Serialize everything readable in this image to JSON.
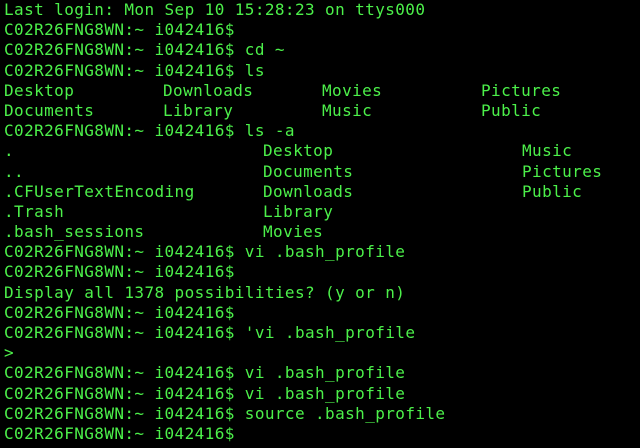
{
  "colors": {
    "background": "#000000",
    "text": "#4CF04A"
  },
  "terminal": {
    "login_line": "Last login: Mon Sep 10 15:28:23 on ttys000",
    "prompt": "C02R26FNG8WN:~ i042416$",
    "lines": [
      {
        "type": "prompt",
        "command": ""
      },
      {
        "type": "prompt",
        "command": "cd ~"
      },
      {
        "type": "prompt",
        "command": "ls"
      },
      {
        "type": "ls4",
        "cells": [
          "Desktop",
          "Downloads",
          "Movies",
          "Pictures"
        ]
      },
      {
        "type": "ls4",
        "cells": [
          "Documents",
          "Library",
          "Music",
          "Public"
        ]
      },
      {
        "type": "prompt",
        "command": "ls -a"
      },
      {
        "type": "ls3",
        "cells": [
          ".",
          "Desktop",
          "Music"
        ]
      },
      {
        "type": "ls3",
        "cells": [
          "..",
          "Documents",
          "Pictures"
        ]
      },
      {
        "type": "ls3",
        "cells": [
          ".CFUserTextEncoding",
          "Downloads",
          "Public"
        ]
      },
      {
        "type": "ls3",
        "cells": [
          ".Trash",
          "Library",
          ""
        ]
      },
      {
        "type": "ls3",
        "cells": [
          ".bash_sessions",
          "Movies",
          ""
        ]
      },
      {
        "type": "prompt",
        "command": "vi .bash_profile"
      },
      {
        "type": "prompt",
        "command": ""
      },
      {
        "type": "text",
        "text": "Display all 1378 possibilities? (y or n)"
      },
      {
        "type": "prompt",
        "command": ""
      },
      {
        "type": "prompt",
        "command": "'vi .bash_profile"
      },
      {
        "type": "text",
        "text": ">"
      },
      {
        "type": "prompt",
        "command": "vi .bash_profile"
      },
      {
        "type": "prompt",
        "command": "vi .bash_profile"
      },
      {
        "type": "prompt",
        "command": "source .bash_profile"
      },
      {
        "type": "prompt",
        "command": ""
      }
    ]
  }
}
